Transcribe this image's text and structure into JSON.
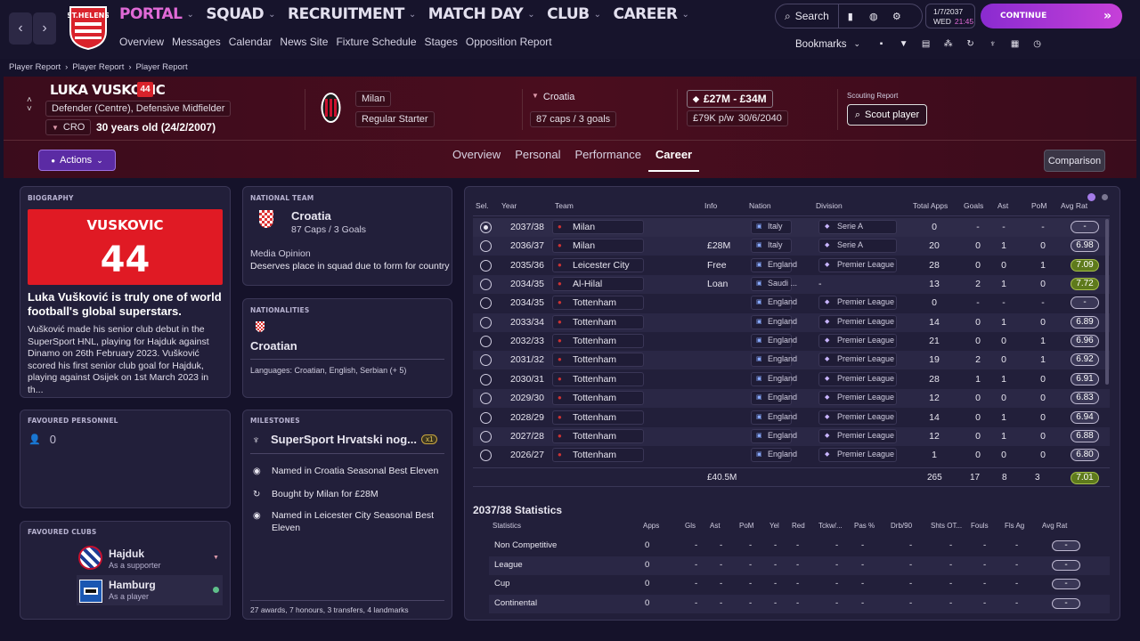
{
  "topnav": {
    "menus": [
      "PORTAL",
      "SQUAD",
      "RECRUITMENT",
      "MATCH DAY",
      "CLUB",
      "CAREER"
    ],
    "sub": [
      "Overview",
      "Messages",
      "Calendar",
      "News Site",
      "Fixture Schedule",
      "Stages",
      "Opposition Report"
    ],
    "search": "Search",
    "date": "1/7/2037",
    "day": "WED",
    "time": "21:45",
    "continue": "CONTINUE",
    "bookmarks": "Bookmarks"
  },
  "breadcrumb": [
    "Player Report",
    "Player Report",
    "Player Report"
  ],
  "player": {
    "name": "LUKA VUSKOVIC",
    "number": "44",
    "positions": "Defender (Centre), Defensive Midfielder",
    "nation_code": "CRO",
    "age": "30 years old (24/2/2007)",
    "club": "Milan",
    "role": "Regular Starter",
    "nation": "Croatia",
    "caps": "87 caps / 3 goals",
    "value": "£27M - £34M",
    "wage": "£79K p/w",
    "contract": "30/6/2040",
    "scouting_label": "Scouting Report",
    "scout_button": "Scout player"
  },
  "tabs": [
    "Overview",
    "Personal",
    "Performance",
    "Career"
  ],
  "actions": "Actions",
  "comparison": "Comparison",
  "bio": {
    "title": "BIOGRAPHY",
    "banner_name": "VUSKOVIC",
    "banner_num": "44",
    "headline": "Luka Vušković is truly one of world football's global superstars.",
    "text": "Vušković made his senior club debut in the SuperSport HNL, playing for Hajduk against Dinamo on 26th February 2023. Vušković scored his first senior club goal for Hajduk, playing against Osijek on 1st March 2023 in th..."
  },
  "national": {
    "title": "NATIONAL TEAM",
    "team": "Croatia",
    "caps": "87 Caps / 3 Goals",
    "media_label": "Media Opinion",
    "media": "Deserves place in squad due to form for country"
  },
  "nationalities": {
    "title": "NATIONALITIES",
    "name": "Croatian",
    "languages": "Languages: Croatian, English, Serbian (+ 5)"
  },
  "personnel": {
    "title": "FAVOURED PERSONNEL",
    "count": "0"
  },
  "milestones": {
    "title": "MILESTONES",
    "headline": "SuperSport Hrvatski nog...",
    "badge": "x1",
    "items": [
      "Named in Croatia Seasonal Best Eleven",
      "Bought by Milan for £28M",
      "Named in Leicester City Seasonal Best Eleven"
    ],
    "footer": "27 awards, 7 honours, 3 transfers, 4 landmarks"
  },
  "clubs": {
    "title": "FAVOURED CLUBS",
    "items": [
      {
        "name": "Hajduk",
        "sub": "As a supporter"
      },
      {
        "name": "Hamburg",
        "sub": "As a player"
      }
    ]
  },
  "career": {
    "headers": [
      "Sel.",
      "Year",
      "Team",
      "Info",
      "Nation",
      "Division",
      "Total Apps",
      "Goals",
      "Ast",
      "PoM",
      "Avg Rat"
    ],
    "rows": [
      [
        "2037/38",
        "Milan",
        "",
        "Italy",
        "Serie A",
        "0",
        "-",
        "-",
        "-",
        "-"
      ],
      [
        "2036/37",
        "Milan",
        "£28M",
        "Italy",
        "Serie A",
        "20",
        "0",
        "1",
        "0",
        "6.98"
      ],
      [
        "2035/36",
        "Leicester City",
        "Free",
        "England",
        "Premier League",
        "28",
        "0",
        "0",
        "1",
        "7.09"
      ],
      [
        "2034/35",
        "Al-Hilal",
        "Loan",
        "Saudi ...",
        "-",
        "13",
        "2",
        "1",
        "0",
        "7.72"
      ],
      [
        "2034/35",
        "Tottenham",
        "",
        "England",
        "Premier League",
        "0",
        "-",
        "-",
        "-",
        "-"
      ],
      [
        "2033/34",
        "Tottenham",
        "",
        "England",
        "Premier League",
        "14",
        "0",
        "1",
        "0",
        "6.89"
      ],
      [
        "2032/33",
        "Tottenham",
        "",
        "England",
        "Premier League",
        "21",
        "0",
        "0",
        "1",
        "6.96"
      ],
      [
        "2031/32",
        "Tottenham",
        "",
        "England",
        "Premier League",
        "19",
        "2",
        "0",
        "1",
        "6.92"
      ],
      [
        "2030/31",
        "Tottenham",
        "",
        "England",
        "Premier League",
        "28",
        "1",
        "1",
        "0",
        "6.91"
      ],
      [
        "2029/30",
        "Tottenham",
        "",
        "England",
        "Premier League",
        "12",
        "0",
        "0",
        "0",
        "6.83"
      ],
      [
        "2028/29",
        "Tottenham",
        "",
        "England",
        "Premier League",
        "14",
        "0",
        "1",
        "0",
        "6.94"
      ],
      [
        "2027/28",
        "Tottenham",
        "",
        "England",
        "Premier League",
        "12",
        "0",
        "1",
        "0",
        "6.88"
      ],
      [
        "2026/27",
        "Tottenham",
        "",
        "England",
        "Premier League",
        "1",
        "0",
        "0",
        "0",
        "6.80"
      ]
    ],
    "totals": [
      "£40.5M",
      "265",
      "17",
      "8",
      "3",
      "7.01"
    ]
  },
  "stats": {
    "title": "2037/38 Statistics",
    "headers": [
      "Statistics",
      "Apps",
      "Gls",
      "Ast",
      "PoM",
      "Yel",
      "Red",
      "Tckw/...",
      "Pas %",
      "Drb/90",
      "Shts OT...",
      "Fouls",
      "Fls Ag",
      "Avg Rat"
    ],
    "rows": [
      "Non Competitive",
      "League",
      "Cup",
      "Continental"
    ],
    "apps": "0",
    "dash": "-"
  }
}
